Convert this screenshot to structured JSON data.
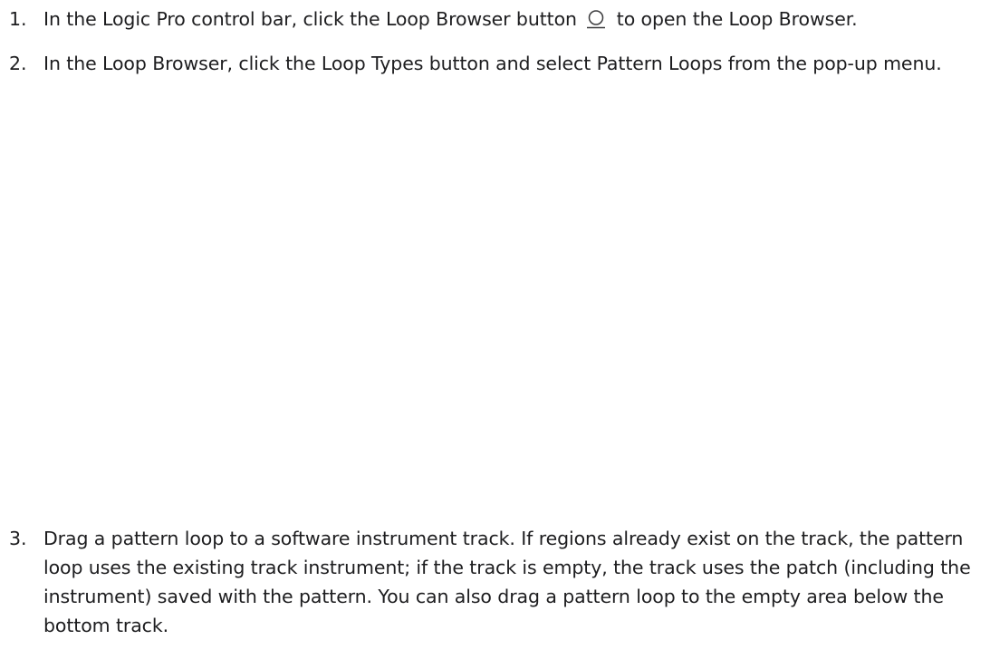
{
  "steps": [
    {
      "number": "1.",
      "text_before_icon": "In the Logic Pro control bar, click the Loop Browser button",
      "icon": "loop-browser-icon",
      "text_after_icon": "to open the Loop Browser."
    },
    {
      "number": "2.",
      "text": "In the Loop Browser, click the Loop Types button and select Pattern Loops from the pop-up menu."
    },
    {
      "number": "3.",
      "text": "Drag a pattern loop to a software instrument track. If regions already exist on the track, the pattern loop uses the existing track instrument; if the track is empty, the track uses the patch (including the instrument) saved with the pattern. You can also drag a pattern loop to the empty area below the bottom track."
    }
  ]
}
